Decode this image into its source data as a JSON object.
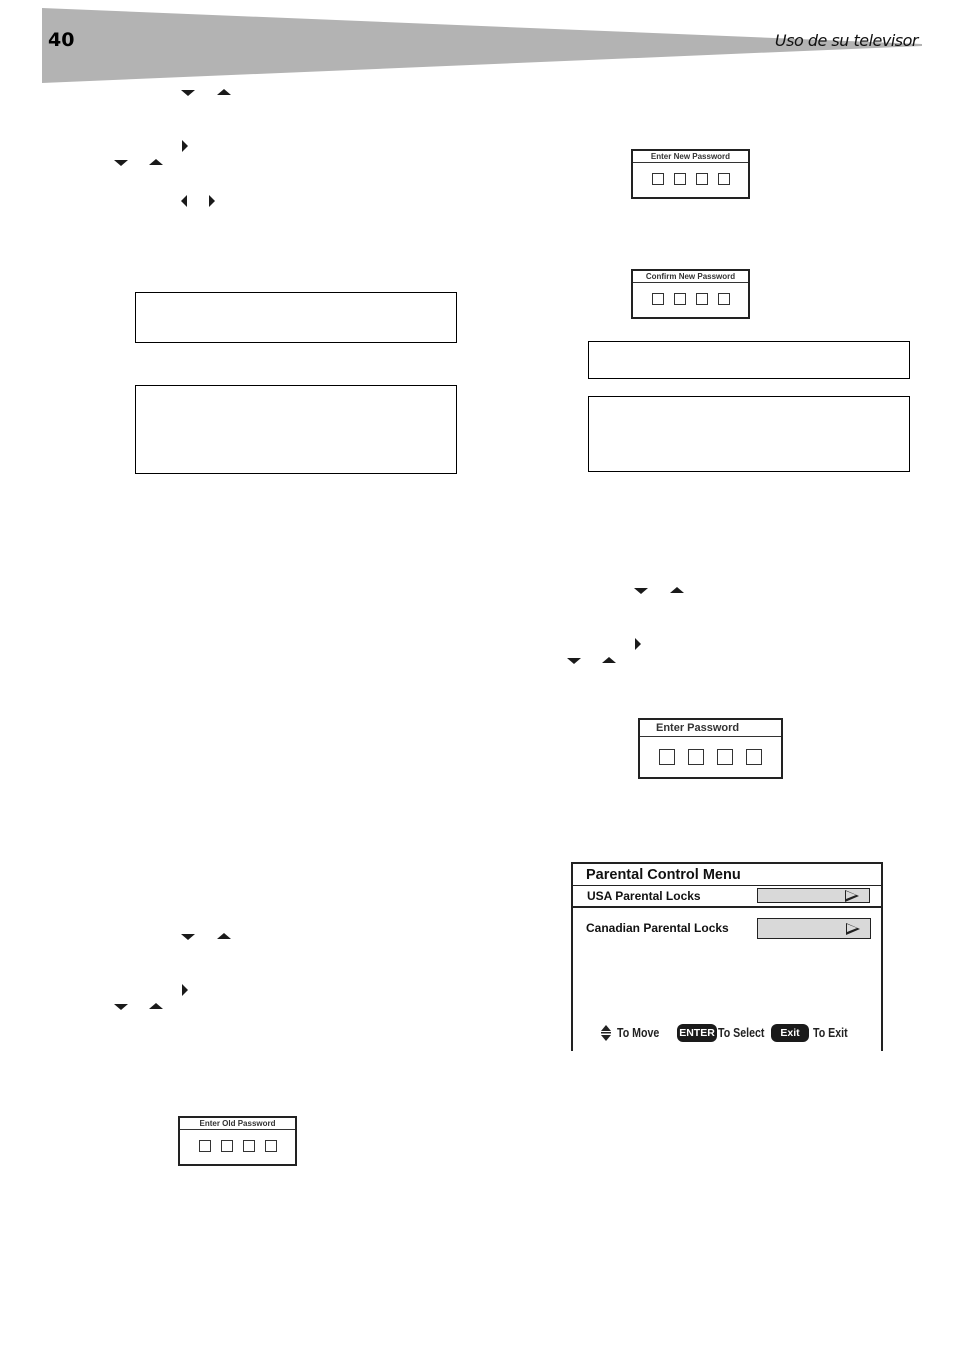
{
  "header": {
    "page_number": "40",
    "section_title": "Uso de su televisor",
    "wedge_color": "#b3b3b3"
  },
  "icons": {
    "arrow_down": "down-arrow",
    "arrow_up": "up-arrow",
    "arrow_left": "left-arrow",
    "arrow_right": "right-arrow"
  },
  "dialogs": {
    "enter_new_password": {
      "title": "Enter New Password",
      "slots": 4
    },
    "confirm_new_password": {
      "title": "Confirm New Password",
      "slots": 4
    },
    "enter_password": {
      "title": "Enter  Password",
      "slots": 4
    },
    "enter_old_password": {
      "title": "Enter Old Password",
      "slots": 4
    }
  },
  "parental_menu": {
    "title": "Parental Control Menu",
    "items": [
      {
        "label": "USA Parental Locks"
      },
      {
        "label": "Canadian Parental Locks"
      }
    ],
    "footer": {
      "move_label": "To Move",
      "enter_key": "ENTER",
      "select_label": "To Select",
      "exit_key": "Exit",
      "exit_label": "To Exit"
    },
    "bar_color": "#d9d9d9"
  }
}
